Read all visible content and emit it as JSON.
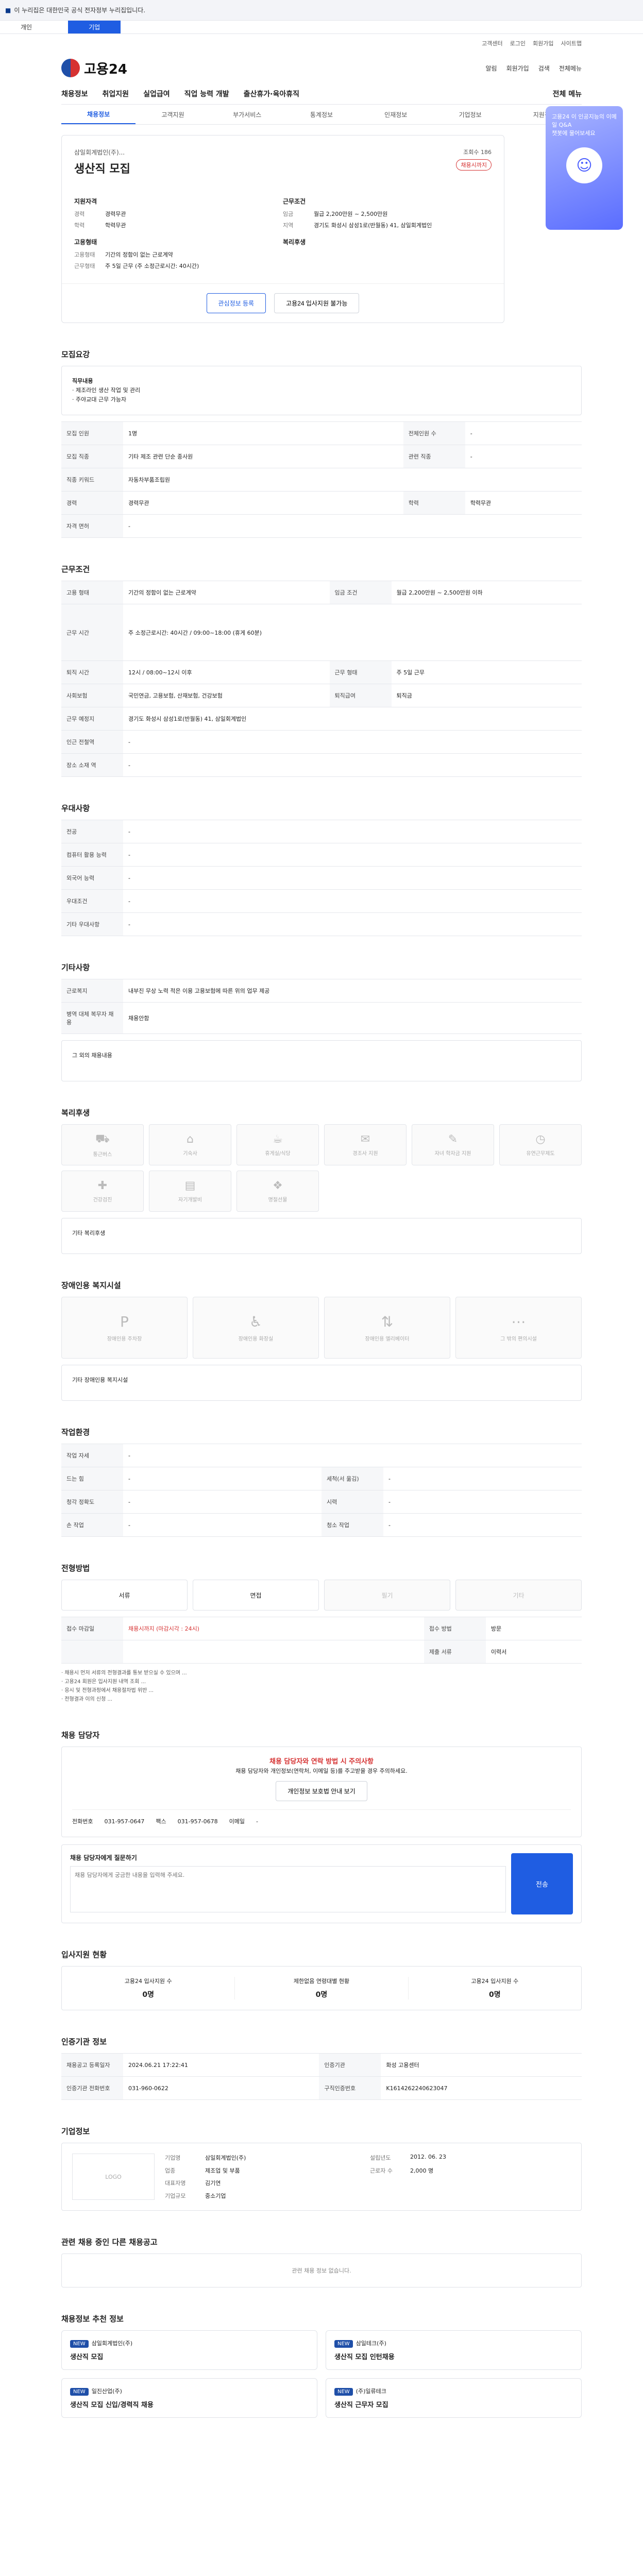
{
  "gov_banner": "이 누리집은 대한민국 공식 전자정부 누리집입니다.",
  "top_tabs": [
    "개인",
    "기업"
  ],
  "util_links": [
    "고객센터",
    "로그인",
    "회원가입",
    "사이트맵"
  ],
  "logo_text": "고용24",
  "header_icons": [
    "알림",
    "회원가입",
    "검색",
    "전체메뉴"
  ],
  "gnb": [
    "채용정보",
    "취업지원",
    "실업급여",
    "직업 능력 개발",
    "출산휴가·육아휴직"
  ],
  "gnb_right": "전체 메뉴",
  "subnav": [
    "채용정보",
    "고객지원",
    "부가서비스",
    "통계정보",
    "인재정보",
    "기업정보",
    "지원정보"
  ],
  "banner": {
    "text": "고용24 이 인공지능의 이메일 Q&A",
    "sub": "챗봇에 물어보세요"
  },
  "job": {
    "org": "삼일회계법인(주)...",
    "title": "생산직 모집",
    "top_right": "조회수 186",
    "pill": "채용시까지",
    "qual_title": "지원자격",
    "qual": [
      [
        "경력",
        "경력무관"
      ],
      [
        "학력",
        "학력무관"
      ]
    ],
    "cond_title": "근무조건",
    "cond": [
      [
        "임금",
        "월급 2,200만원 ~ 2,500만원"
      ],
      [
        "지역",
        "경기도 화성시 삼성1로(반월동) 41, 삼일회계법인"
      ]
    ],
    "work_title": "고용형태",
    "work": [
      [
        "고용형태",
        "기간의 정함이 없는 근로계약"
      ],
      [
        "근무형태",
        "주 5일 근무 (주 소정근로시간: 40시간)"
      ]
    ],
    "welfare_title": "복리후생"
  },
  "btns": {
    "scrap": "관심정보 등록",
    "share": "고용24 입사지원 불가능"
  },
  "recruit": {
    "title": "모집요강",
    "desc_title": "직무내용",
    "desc": [
      "· 제조라인 생산 작업 및 관리",
      "· 주야교대 근무 가능자"
    ],
    "rows": [
      [
        "모집 인원",
        "1명",
        "전체인원 수",
        "-"
      ],
      [
        "모집 직종",
        "기타 제조 관련 단순 종사원",
        "관련 직종",
        "-"
      ],
      [
        "직종 키워드",
        "자동차부품조립원",
        "",
        ""
      ],
      [
        "경력",
        "경력무관",
        "학력",
        "학력무관"
      ],
      [
        "자격 면허",
        "-",
        "",
        ""
      ]
    ]
  },
  "conditions": {
    "title": "근무조건",
    "rows": [
      [
        "고용 형태",
        "기간의 정함이 없는 근로계약",
        "임금 조건",
        "월급 2,200만원 ~ 2,500만원 이하"
      ],
      [
        "근무 시간",
        "주 소정근로시간: 40시간 / 09:00~18:00 (휴게 60분)",
        "",
        ""
      ],
      [
        "퇴직 시간",
        "12시 / 08:00~12시 이후",
        "근무 형태",
        "주 5일 근무"
      ],
      [
        "사회보험",
        "국민연금, 고용보험, 산재보험, 건강보험",
        "퇴직급여",
        "퇴직금"
      ],
      [
        "근무 예정지",
        "경기도 화성시 삼성1로(반월동) 41, 삼일회계법인",
        "",
        ""
      ],
      [
        "인근 전철역",
        "-",
        "",
        ""
      ],
      [
        "장소 소재 역",
        "-",
        "",
        ""
      ]
    ]
  },
  "prefer": {
    "title": "우대사항",
    "rows": [
      [
        "전공",
        "-"
      ],
      [
        "컴퓨터 활용 능력",
        "-"
      ],
      [
        "외국어 능력",
        "-"
      ],
      [
        "우대조건",
        "-"
      ],
      [
        "기타 우대사항",
        "-"
      ]
    ]
  },
  "etc": {
    "title": "기타사항",
    "rows": [
      [
        "근로복지",
        "내부진 무상 노력 적은 이용 고용보험에 따른 위의 업무 제공"
      ],
      [
        "병역 대체 복무자 채용",
        "채용안함"
      ]
    ],
    "box_title": "그 외의 채용내용"
  },
  "welfare": {
    "title": "복리후생",
    "items": [
      "통근버스",
      "기숙사",
      "휴게실/식당",
      "경조사 지원",
      "자녀 학자금 지원",
      "유연근무제도",
      "건강검진",
      "자기개발비",
      "명절선물"
    ],
    "box_title": "기타 복리후생"
  },
  "disabled": {
    "title": "장애인용 복지시설",
    "items": [
      "장애인용 주차장",
      "장애인용 화장실",
      "장애인용 엘리베이터",
      "그 밖의 편의시설"
    ],
    "box_title": "기타 장애인용 복지시설"
  },
  "env": {
    "title": "작업환경",
    "rows": [
      [
        "작업 자세",
        "-",
        "",
        ""
      ],
      [
        "드는 힘",
        "-",
        "세척(서 옮김)",
        "-"
      ],
      [
        "청각 정확도",
        "-",
        "시력",
        "-"
      ],
      [
        "손 작업",
        "-",
        "청소 작업",
        "-"
      ]
    ]
  },
  "apply": {
    "title": "전형방법",
    "steps": [
      "서류",
      "면접",
      "필기",
      "기타"
    ],
    "rows": [
      [
        "접수 마감일",
        "채용시까지 (마감시각 : 24시)",
        "접수 방법",
        "방문"
      ],
      [
        "",
        "",
        "제출 서류",
        "이력서"
      ]
    ],
    "notes": [
      "· 채용시 먼저 서류의 전형결과를 통보 받으실 수 있으며 ...",
      "· 고용24 회원은 입사지원 내역 조회 ...",
      "· 응시 및 전형과정에서 채용절차법 위반 ...",
      "· 전형결과 이의 신청 ..."
    ]
  },
  "manager": {
    "title": "채용 담당자",
    "warn": "채용 담당자와 연락 방법 시 주의사항",
    "warn_text": [
      "채용 담당자와 개인정보(연락처, 이메일 등)를 주고받을 경우 주의하세요.",
      "개인정보 보호법 안내 보기"
    ],
    "contact": [
      [
        "전화번호",
        "031-957-0647"
      ],
      [
        "팩스",
        "031-957-0678"
      ],
      [
        "이메일",
        "-"
      ]
    ],
    "qa_title": "채용 담당자에게 질문하기",
    "qa_placeholder": "채용 담당자에게 궁금한 내용을 입력해 주세요.",
    "qa_btn": "전송"
  },
  "applicants": {
    "title": "입사지원 현황",
    "items": [
      [
        "고용24 입사지원 수",
        "0명"
      ],
      [
        "제한없음 연령대별 현황",
        "0명"
      ],
      [
        "고용24 입사지원 수",
        "0명"
      ]
    ]
  },
  "agency": {
    "title": "인증기관 정보",
    "rows": [
      [
        "채용공고 등록일자",
        "2024.06.21 17:22:41",
        "인증기관",
        "화성 고용센터"
      ],
      [
        "인증기관 전화번호",
        "031-960-0622",
        "구직인증번호",
        "K1614262240623047"
      ]
    ]
  },
  "company": {
    "title": "기업정보",
    "logo": "LOGO",
    "rows": [
      [
        "기업명",
        "삼일회계법인(주)",
        "설립년도",
        "2012. 06. 23"
      ],
      [
        "업종",
        "제조업 및 부품",
        "근로자 수",
        "2,000 명"
      ],
      [
        "대표자명",
        "김기연",
        "",
        ""
      ],
      [
        "기업규모",
        "중소기업",
        "",
        ""
      ]
    ]
  },
  "similar": {
    "title": "관련 채용 중인 다른 채용공고",
    "empty": "관련 채용 정보 없습니다."
  },
  "recommend": {
    "title": "채용정보 추천 정보",
    "items": [
      [
        "삼일회계법인(주)",
        "생산직 모집"
      ],
      [
        "삼일테크(주)",
        "생산직 모집 인턴채용"
      ],
      [
        "일진산업(주)",
        "생산직 모집 신입/경력직 채용"
      ],
      [
        "(주)일류테크",
        "생산직 근무자 모집"
      ]
    ]
  }
}
